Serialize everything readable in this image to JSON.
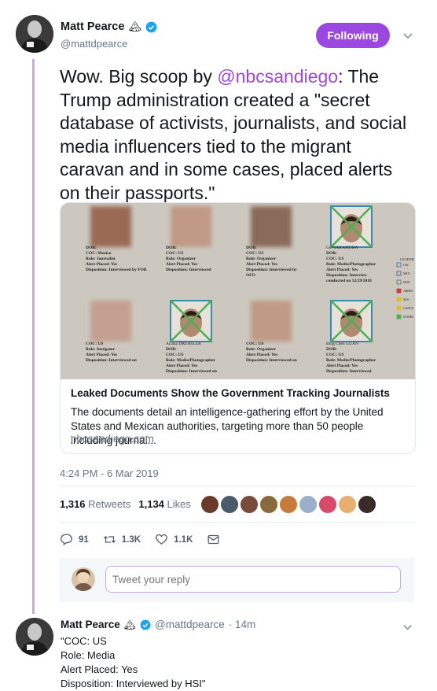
{
  "tweet": {
    "display_name": "Matt Pearce",
    "name_emoji": "🏔",
    "handle": "@mattdpearce",
    "follow_label": "Following",
    "text_before": "Wow. Big scoop by ",
    "mention": "@nbcsandiego",
    "text_after": ": The Trump administration created a \"secret database of activists, journalists, and social media influencers tied to the migrant caravan and in some cases, placed alerts on their passports.\"",
    "card": {
      "title": "Leaked Documents Show the Government Tracking Journalists",
      "description": "The documents detail an intelligence-gathering effort by the United States and Mexican authorities, targeting more than 50 people including journal...",
      "domain": "nbcsandiego.com",
      "image_entries": [
        {
          "name": "",
          "lines": [
            "DOB:",
            "COC: Mexico",
            "Role: Journalist",
            "Alert Placed: Yes",
            "Disposition: Interviewed by FOB"
          ]
        },
        {
          "name": "",
          "lines": [
            "DOB:",
            "COC: US",
            "Role: Organizer",
            "Alert Placed: Yes",
            "Disposition: Interviewed"
          ]
        },
        {
          "name": "",
          "lines": [
            "DOB:",
            "COC: US",
            "Role: Organizer",
            "Alert Placed: Yes",
            "Disposition: Interviewed by",
            "OFO"
          ]
        },
        {
          "name": "Go NAKAMURA",
          "lines": [
            "DOB:",
            "COC: US",
            "Role: Media/Photographer",
            "Alert Placed: Yes",
            "Disposition: Interview",
            "conducted on 12/29/2018"
          ]
        },
        {
          "name": "",
          "lines": [
            "COC: US",
            "Role: Instigator",
            "Alert Placed: Yes",
            "Disposition: Interviewed on"
          ]
        },
        {
          "name": "Ariana DREHSLER",
          "lines": [
            "DOB:",
            "COC: US",
            "Role: Media/Photographer",
            "Alert Placed: Yes",
            "Disposition: Interviewed on"
          ]
        },
        {
          "name": "",
          "lines": [
            "COC: US",
            "Role: Organizer",
            "Alert Placed: Yes",
            "Disposition: Interviewed on"
          ]
        },
        {
          "name": "Bing Chen GUAN",
          "lines": [
            "DOB:",
            "COC: US",
            "Role: Media/Photographer",
            "Alert Placed: Yes",
            "Disposition: Interviewed"
          ]
        }
      ],
      "legend_title": "LEGEND",
      "legend_items": [
        "USC",
        "MEX",
        "HON",
        "ARRES",
        "SUS",
        "CANCE",
        "INTERV"
      ]
    },
    "timestamp": "4:24 PM - 6 Mar 2019",
    "retweets_count": "1,316",
    "retweets_label": "Retweets",
    "likes_count": "1,134",
    "likes_label": "Likes",
    "actions": {
      "reply_count": "91",
      "retweet_count": "1.3K",
      "like_count": "1.1K"
    },
    "reply_placeholder": "Tweet your reply",
    "liker_colors": [
      "#6b3a2a",
      "#4a5a6a",
      "#7a4a3a",
      "#8a6a3a",
      "#c87a3a",
      "#9ab0c8",
      "#d84a6a",
      "#e8b070",
      "#3a2a2a"
    ]
  },
  "reply": {
    "display_name": "Matt Pearce",
    "name_emoji": "🏔",
    "handle": "@mattdpearce",
    "time": "· 14m",
    "text": "\"COC: US\nRole: Media\nAlert Placed: Yes\nDisposition: Interviewed by HSI\""
  },
  "colors": {
    "accent": "#9b48e0",
    "verified": "#1da1f2",
    "muted": "#657786"
  }
}
